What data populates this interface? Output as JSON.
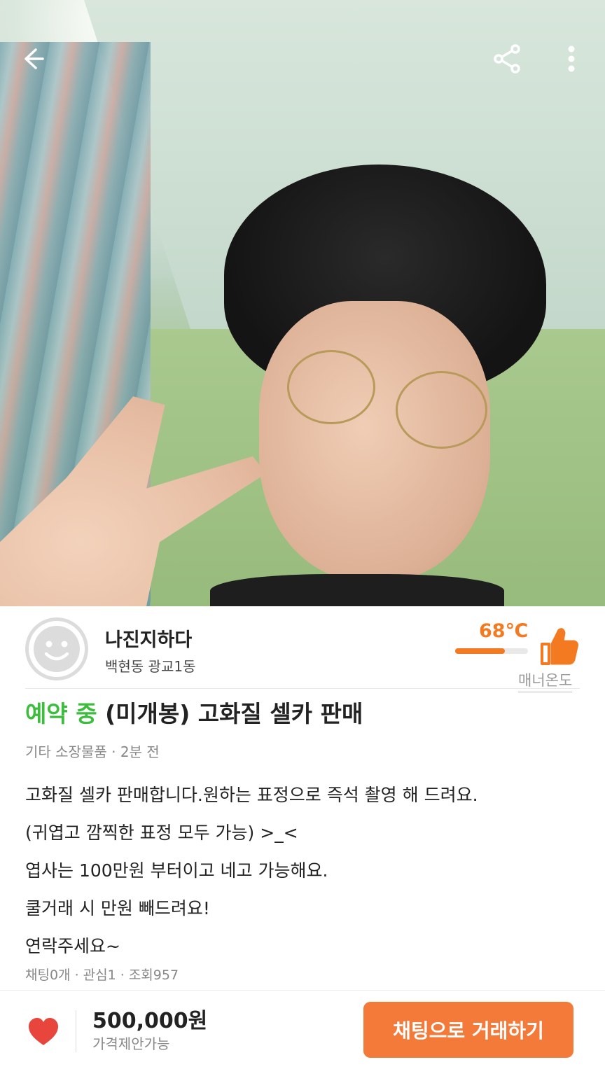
{
  "seller": {
    "name": "나진지하다",
    "location": "백현동 광교1동",
    "manner_temp": "68℃",
    "manner_temp_value": 68,
    "manner_label": "매너온도"
  },
  "post": {
    "status": "예약 중",
    "title": "(미개봉) 고화질 셀카 판매",
    "meta": "기타 소장물품 · 2분 전",
    "description": [
      "고화질 셀카 판매합니다.원하는 표정으로 즉석 촬영 해 드려요.",
      "(귀엽고 깜찍한 표정 모두 가능)   >_<",
      "엽사는 100만원 부터이고 네고 가능해요.",
      "쿨거래 시 만원 빼드려요!",
      "연락주세요~"
    ],
    "stats": "채팅0개 · 관심1 · 조회957"
  },
  "bottom": {
    "price": "500,000원",
    "price_note": "가격제안가능",
    "cta_label": "채팅으로 거래하기"
  },
  "colors": {
    "accent": "#f47a3a",
    "status_green": "#3dbd3d",
    "heart_red": "#e8453c"
  },
  "icons": [
    "back-arrow-icon",
    "share-icon",
    "more-vertical-icon",
    "avatar-smiley-icon",
    "thumbs-up-icon",
    "heart-icon"
  ]
}
